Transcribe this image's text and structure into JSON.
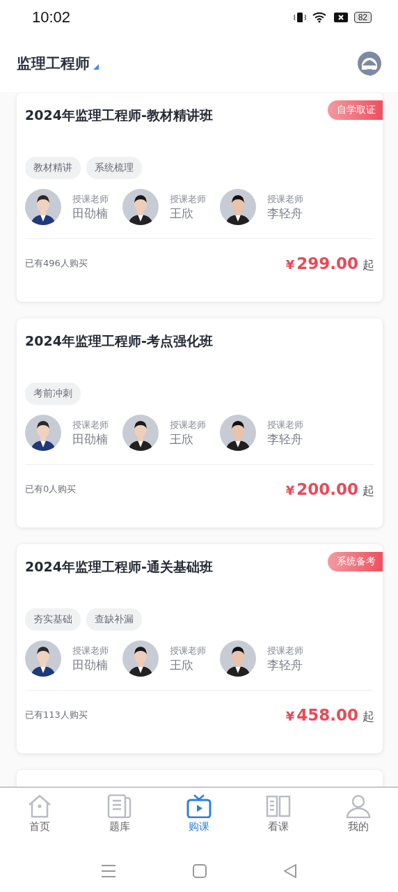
{
  "status_bar": {
    "time": "10:02",
    "battery": "82"
  },
  "header": {
    "title": "监理工程师"
  },
  "courses": [
    {
      "title": "2024年监理工程师-教材精讲班",
      "badge": "自学取证",
      "tags": [
        "教材精讲",
        "系统梳理"
      ],
      "teachers": [
        {
          "role": "授课老师",
          "name": "田劭楠"
        },
        {
          "role": "授课老师",
          "name": "王欣"
        },
        {
          "role": "授课老师",
          "name": "李轻舟"
        }
      ],
      "buyers": "已有496人购买",
      "currency": "¥",
      "price": "299.00",
      "suffix": "起"
    },
    {
      "title": "2024年监理工程师-考点强化班",
      "tags": [
        "考前冲刺"
      ],
      "teachers": [
        {
          "role": "授课老师",
          "name": "田劭楠"
        },
        {
          "role": "授课老师",
          "name": "王欣"
        },
        {
          "role": "授课老师",
          "name": "李轻舟"
        }
      ],
      "buyers": "已有0人购买",
      "currency": "¥",
      "price": "200.00",
      "suffix": "起"
    },
    {
      "title": "2024年监理工程师-通关基础班",
      "badge": "系统备考",
      "tags": [
        "夯实基础",
        "查缺补漏"
      ],
      "teachers": [
        {
          "role": "授课老师",
          "name": "田劭楠"
        },
        {
          "role": "授课老师",
          "name": "王欣"
        },
        {
          "role": "授课老师",
          "name": "李轻舟"
        }
      ],
      "buyers": "已有113人购买",
      "currency": "¥",
      "price": "458.00",
      "suffix": "起"
    }
  ],
  "tab_bar": [
    {
      "label": "首页",
      "selected": false
    },
    {
      "label": "题库",
      "selected": false
    },
    {
      "label": "购课",
      "selected": true
    },
    {
      "label": "看课",
      "selected": false
    },
    {
      "label": "我的",
      "selected": false
    }
  ]
}
